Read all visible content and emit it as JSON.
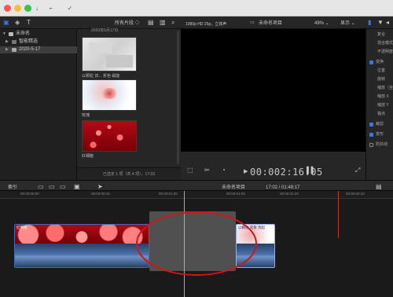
{
  "toolbar": {
    "key_icon": "key-icon",
    "check_icon": "checkmark-icon",
    "download_icon": "download-icon"
  },
  "browser_header": {
    "filter_label": "所有片段 ◇",
    "clip_date": "2020年5月17日"
  },
  "libraries": {
    "items": [
      {
        "label": "未命名"
      },
      {
        "label": "智能精选"
      },
      {
        "label": "2020-5-17"
      }
    ]
  },
  "browser": {
    "items": [
      {
        "caption": "以颗粒 双... 折色 磁能"
      },
      {
        "caption": "玫瑰"
      },
      {
        "caption": "红细胞"
      }
    ],
    "footer": "已选定 1 项（共 4 项），17:03"
  },
  "viewer": {
    "format_label": "1080p HD 25p，立体声",
    "project_title": "未命名项目",
    "zoom": "49% ⌄",
    "display_label": "显示 ⌄",
    "timecode": "00:002:16:05"
  },
  "inspector": {
    "items": [
      {
        "label": "复合"
      },
      {
        "label": "混合模式"
      },
      {
        "label": "不透明度"
      },
      {
        "label": "变换",
        "checked": true
      },
      {
        "label": "位置"
      },
      {
        "label": "旋转"
      },
      {
        "label": "缩放（全部）"
      },
      {
        "label": "缩放 X"
      },
      {
        "label": "缩放 Y"
      },
      {
        "label": "锚点"
      },
      {
        "label": "裁剪",
        "checked": true
      },
      {
        "label": "变形",
        "checked": true
      },
      {
        "label": "防抖动",
        "checked": false
      }
    ]
  },
  "timeline": {
    "index_label": "索引",
    "project_name": "未命名项目",
    "duration": "17:02 / 01:48:17",
    "ruler": [
      "00:00:00:00",
      "00:00:00:15",
      "00:00:01:00",
      "00:00:01:05",
      "00:00:01:20",
      "00:00:02:10"
    ],
    "clips": [
      {
        "label": "红细胞"
      },
      {
        "label": "以颗粒 变紫 亮起"
      }
    ]
  },
  "colors": {
    "annotation": "#d01515",
    "audio_wave": "#2f4c78",
    "gap_clip": "#5a5a5a",
    "accent": "#3b78d8"
  }
}
